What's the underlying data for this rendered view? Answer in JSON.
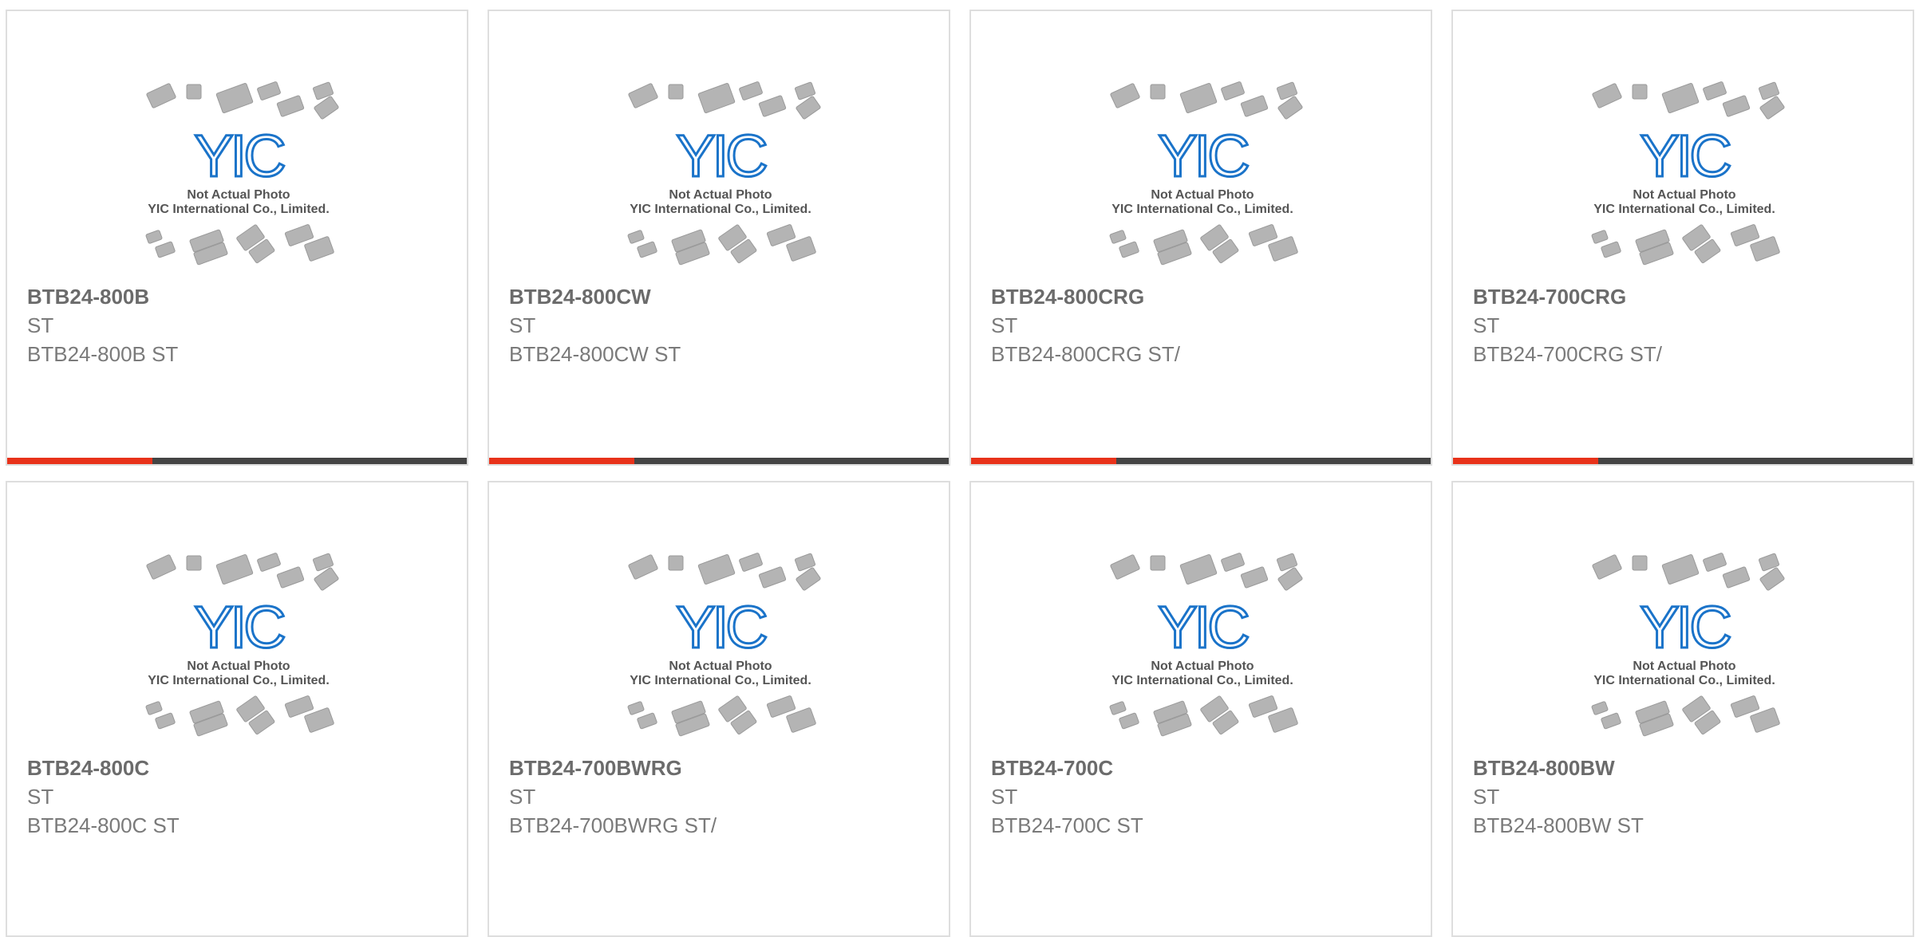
{
  "theme": {
    "accent_color": "#e8321a",
    "bar_color": "#444444",
    "text_color": "#6b6b6b",
    "logo_color": "#1a73c9"
  },
  "placeholder": {
    "logo_text": "YIC",
    "line1": "Not Actual Photo",
    "line2": "YIC International Co., Limited."
  },
  "products": [
    {
      "part": "BTB24-800B",
      "maker": "ST",
      "desc": "BTB24-800B ST",
      "has_bar": true
    },
    {
      "part": "BTB24-800CW",
      "maker": "ST",
      "desc": "BTB24-800CW ST",
      "has_bar": true
    },
    {
      "part": "BTB24-800CRG",
      "maker": "ST",
      "desc": "BTB24-800CRG ST/",
      "has_bar": true
    },
    {
      "part": "BTB24-700CRG",
      "maker": "ST",
      "desc": "BTB24-700CRG ST/",
      "has_bar": true
    },
    {
      "part": "BTB24-800C",
      "maker": "ST",
      "desc": "BTB24-800C ST",
      "has_bar": false
    },
    {
      "part": "BTB24-700BWRG",
      "maker": "ST",
      "desc": "BTB24-700BWRG ST/",
      "has_bar": false
    },
    {
      "part": "BTB24-700C",
      "maker": "ST",
      "desc": "BTB24-700C ST",
      "has_bar": false
    },
    {
      "part": "BTB24-800BW",
      "maker": "ST",
      "desc": "BTB24-800BW ST",
      "has_bar": false
    }
  ]
}
